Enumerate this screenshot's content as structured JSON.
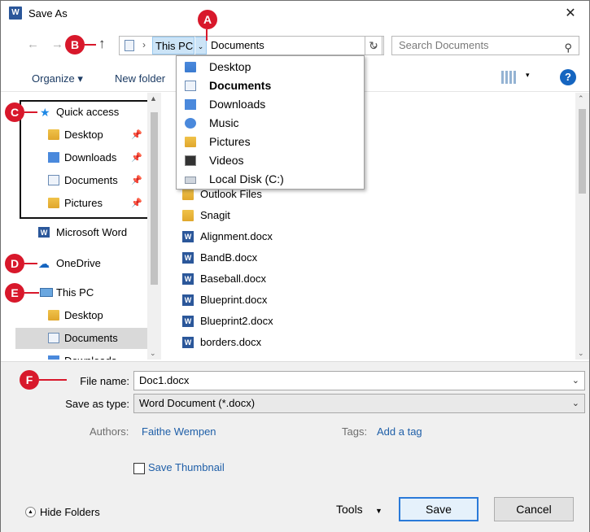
{
  "window": {
    "title": "Save As",
    "app_icon_letter": "W",
    "close_glyph": "✕"
  },
  "nav": {
    "back_glyph": "←",
    "forward_glyph": "→",
    "up_glyph": "↑",
    "address": {
      "crumb_sep": "›",
      "this_pc": "This PC",
      "drop_glyph": "⌄",
      "current": "Documents",
      "dropdown_glyph": "⌄",
      "refresh_glyph": "↻"
    },
    "search_placeholder": "Search Documents",
    "search_glyph": "⚲"
  },
  "toolbar": {
    "organize": "Organize ▾",
    "new_folder": "New folder",
    "view_chev": "▾",
    "help": "?"
  },
  "address_dropdown": [
    {
      "label": "Desktop",
      "icon": "desktop-folder-icon",
      "bold": false
    },
    {
      "label": "Documents",
      "icon": "documents-icon",
      "bold": true
    },
    {
      "label": "Downloads",
      "icon": "downloads-icon",
      "bold": false
    },
    {
      "label": "Music",
      "icon": "music-icon",
      "bold": false
    },
    {
      "label": "Pictures",
      "icon": "pictures-icon",
      "bold": false
    },
    {
      "label": "Videos",
      "icon": "videos-icon",
      "bold": false
    },
    {
      "label": "Local Disk (C:)",
      "icon": "disk-icon",
      "bold": false
    }
  ],
  "sidebar": {
    "quick_access": "Quick access",
    "pinned": [
      {
        "label": "Desktop"
      },
      {
        "label": "Downloads"
      },
      {
        "label": "Documents"
      },
      {
        "label": "Pictures"
      }
    ],
    "pin_glyph": "📌",
    "microsoft_word": "Microsoft Word",
    "onedrive": "OneDrive",
    "this_pc": "This PC",
    "this_pc_items": [
      {
        "label": "Desktop"
      },
      {
        "label": "Documents"
      },
      {
        "label": "Downloads"
      }
    ],
    "scroll_up": "▲",
    "scroll_down": "⌄"
  },
  "files": [
    {
      "name": "Outlook Files",
      "type": "folder"
    },
    {
      "name": "Snagit",
      "type": "folder"
    },
    {
      "name": "Alignment.docx",
      "type": "docx"
    },
    {
      "name": "BandB.docx",
      "type": "docx"
    },
    {
      "name": "Baseball.docx",
      "type": "docx"
    },
    {
      "name": "Blueprint.docx",
      "type": "docx"
    },
    {
      "name": "Blueprint2.docx",
      "type": "docx"
    },
    {
      "name": "borders.docx",
      "type": "docx"
    }
  ],
  "file_scroll": {
    "up": "⌃",
    "down": "⌄"
  },
  "form": {
    "file_name_label": "File name:",
    "file_name_value": "Doc1.docx",
    "save_type_label": "Save as type:",
    "save_type_value": "Word Document (*.docx)",
    "chev": "⌄",
    "authors_label": "Authors:",
    "authors_value": "Faithe Wempen",
    "tags_label": "Tags:",
    "tags_value": "Add a tag",
    "thumbnail_label": "Save Thumbnail"
  },
  "footer": {
    "hide_folders": "Hide Folders",
    "hide_glyph": "▲",
    "tools": "Tools",
    "tools_chev": "▼",
    "save": "Save",
    "cancel": "Cancel"
  },
  "callouts": [
    "A",
    "B",
    "C",
    "D",
    "E",
    "F"
  ],
  "colors": {
    "callout": "#d8182b",
    "link": "#1f5fa8",
    "accent": "#2a7ad9"
  }
}
